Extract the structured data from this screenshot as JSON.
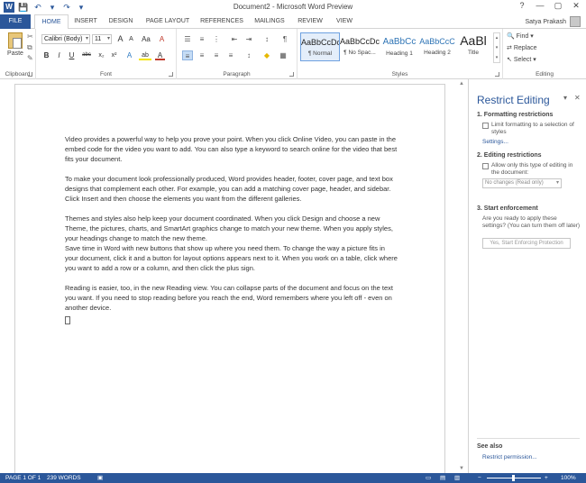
{
  "window": {
    "app_logo": "W",
    "title": "Document2 - Microsoft Word Preview",
    "help": "?",
    "minimize": "—",
    "maximize": "▢",
    "close": "✕"
  },
  "qat": {
    "save": "💾",
    "undo": "↶",
    "undo_more": "▾",
    "redo": "↷",
    "customize": "▾"
  },
  "tabs": [
    {
      "label": "FILE"
    },
    {
      "label": "HOME"
    },
    {
      "label": "INSERT"
    },
    {
      "label": "DESIGN"
    },
    {
      "label": "PAGE LAYOUT"
    },
    {
      "label": "REFERENCES"
    },
    {
      "label": "MAILINGS"
    },
    {
      "label": "REVIEW"
    },
    {
      "label": "VIEW"
    }
  ],
  "user": {
    "name": "Satya Prakash"
  },
  "ribbon": {
    "clipboard": {
      "paste_label": "Paste",
      "group_label": "Clipboard",
      "cut": "✂",
      "copy": "⧉",
      "painter": "✎"
    },
    "font": {
      "family": "Calibri (Body)",
      "size": "11",
      "grow": "A",
      "shrink": "A",
      "case": "Aa",
      "clear": "A",
      "group_label": "Font",
      "bold": "B",
      "italic": "I",
      "underline": "U",
      "strike": "abc",
      "sub": "x₂",
      "sup": "x²",
      "effects": "A",
      "highlight": "ab",
      "color": "A"
    },
    "paragraph": {
      "group_label": "Paragraph",
      "bullets": "☰",
      "numbering": "≡",
      "multilevel": "⋮",
      "outdent": "⇤",
      "indent": "⇥",
      "sort": "↕",
      "show": "¶",
      "left": "≡",
      "center": "≡",
      "right": "≡",
      "justify": "≡",
      "spacing": "↕",
      "shading": "◆",
      "borders": "▦"
    },
    "styles": {
      "group_label": "Styles",
      "items": [
        {
          "sample": "AaBbCcDc",
          "name": "¶ Normal"
        },
        {
          "sample": "AaBbCcDc",
          "name": "¶ No Spac..."
        },
        {
          "sample": "AaBbCc",
          "name": "Heading 1"
        },
        {
          "sample": "AaBbCcC",
          "name": "Heading 2"
        },
        {
          "sample": "AaBl",
          "name": "Title"
        }
      ],
      "scroll": "▴ ▾ ▾"
    },
    "editing": {
      "group_label": "Editing",
      "find": "Find",
      "replace": "Replace",
      "select": "Select"
    }
  },
  "document": {
    "paragraphs": [
      "Video provides a powerful way to help you prove your point. When you click Online Video, you can paste in the embed code for the video you want to add. You can also type a keyword to search online for the video that best fits your document.",
      "To make your document look professionally produced, Word provides header, footer, cover page, and text box designs that complement each other. For example, you can add a matching cover page, header, and sidebar. Click Insert and then choose the elements you want from the different galleries.",
      "Themes and styles also help keep your document coordinated. When you click Design and choose a new Theme, the pictures, charts, and SmartArt graphics change to match your new theme. When you apply styles, your headings change to match the new theme.",
      "Save time in Word with new buttons that show up where you need them. To change the way a picture fits in your document, click it and a button for layout options appears next to it. When you work on a table, click where you want to add a row or a column, and then click the plus sign.",
      "Reading is easier, too, in the new Reading view. You can collapse parts of the document and focus on the text you want. If you need to stop reading before you reach the end, Word remembers where you left off - even on another device."
    ]
  },
  "pane": {
    "title": "Restrict Editing",
    "section1_title": "1. Formatting restrictions",
    "section1_option": "Limit formatting to a selection of styles",
    "section1_link": "Settings...",
    "section2_title": "2. Editing restrictions",
    "section2_option": "Allow only this type of editing in the document:",
    "section2_select": "No changes (Read only)",
    "section3_title": "3. Start enforcement",
    "section3_text": "Are you ready to apply these settings? (You can turn them off later)",
    "section3_button": "Yes, Start Enforcing Protection",
    "see_also": "See also",
    "see_also_link": "Restrict permission...",
    "options": "▾",
    "close": "✕"
  },
  "status": {
    "page": "PAGE 1 OF 1",
    "words": "239 WORDS",
    "zoom": "100%",
    "minus": "−",
    "plus": "+"
  },
  "colors": {
    "accent": "#2b579a"
  }
}
